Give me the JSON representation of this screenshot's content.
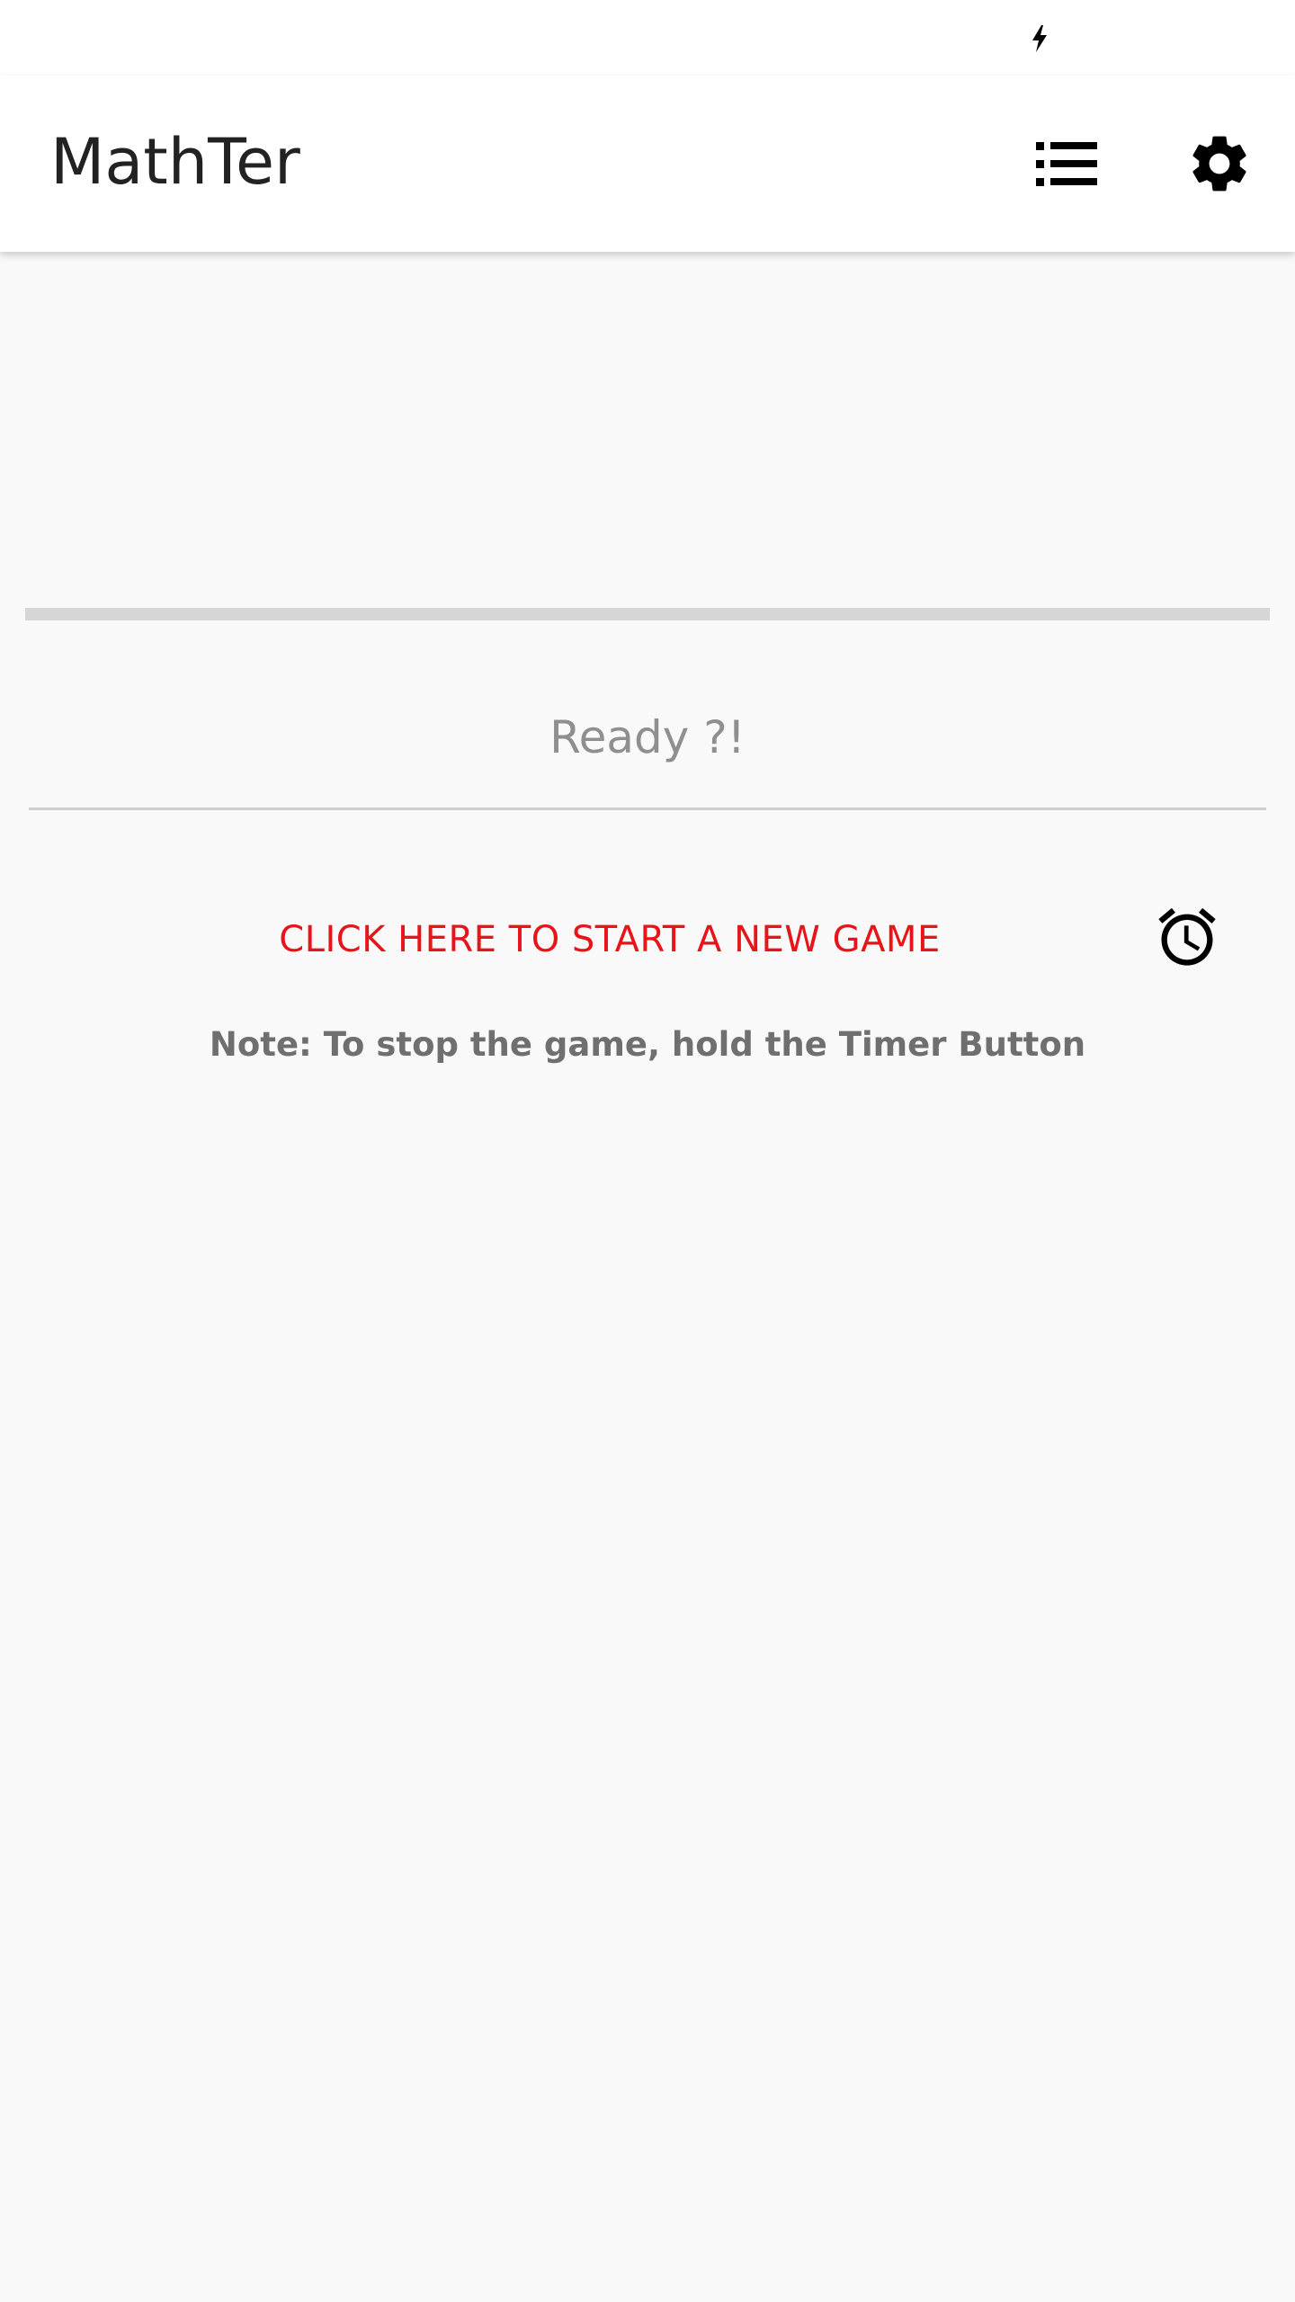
{
  "app_bar": {
    "title": "MathTer",
    "icons": {
      "list": "format-list-icon",
      "settings": "gear-icon"
    }
  },
  "status_bar": {
    "icons": [
      "charging-bolt-icon"
    ]
  },
  "game": {
    "progress_fraction": 0,
    "ready_text": "Ready ?!",
    "start_label": "CLICK HERE TO START A NEW GAME",
    "timer_icon": "alarm-clock-icon",
    "note": "Note: To stop the game, hold the Timer Button"
  },
  "colors": {
    "accent_red": "#e8141a",
    "muted_text": "#8f8f8f",
    "note_text": "#6f6f6f",
    "progress_track": "#d6d6d6",
    "background": "#f9f9f9"
  }
}
